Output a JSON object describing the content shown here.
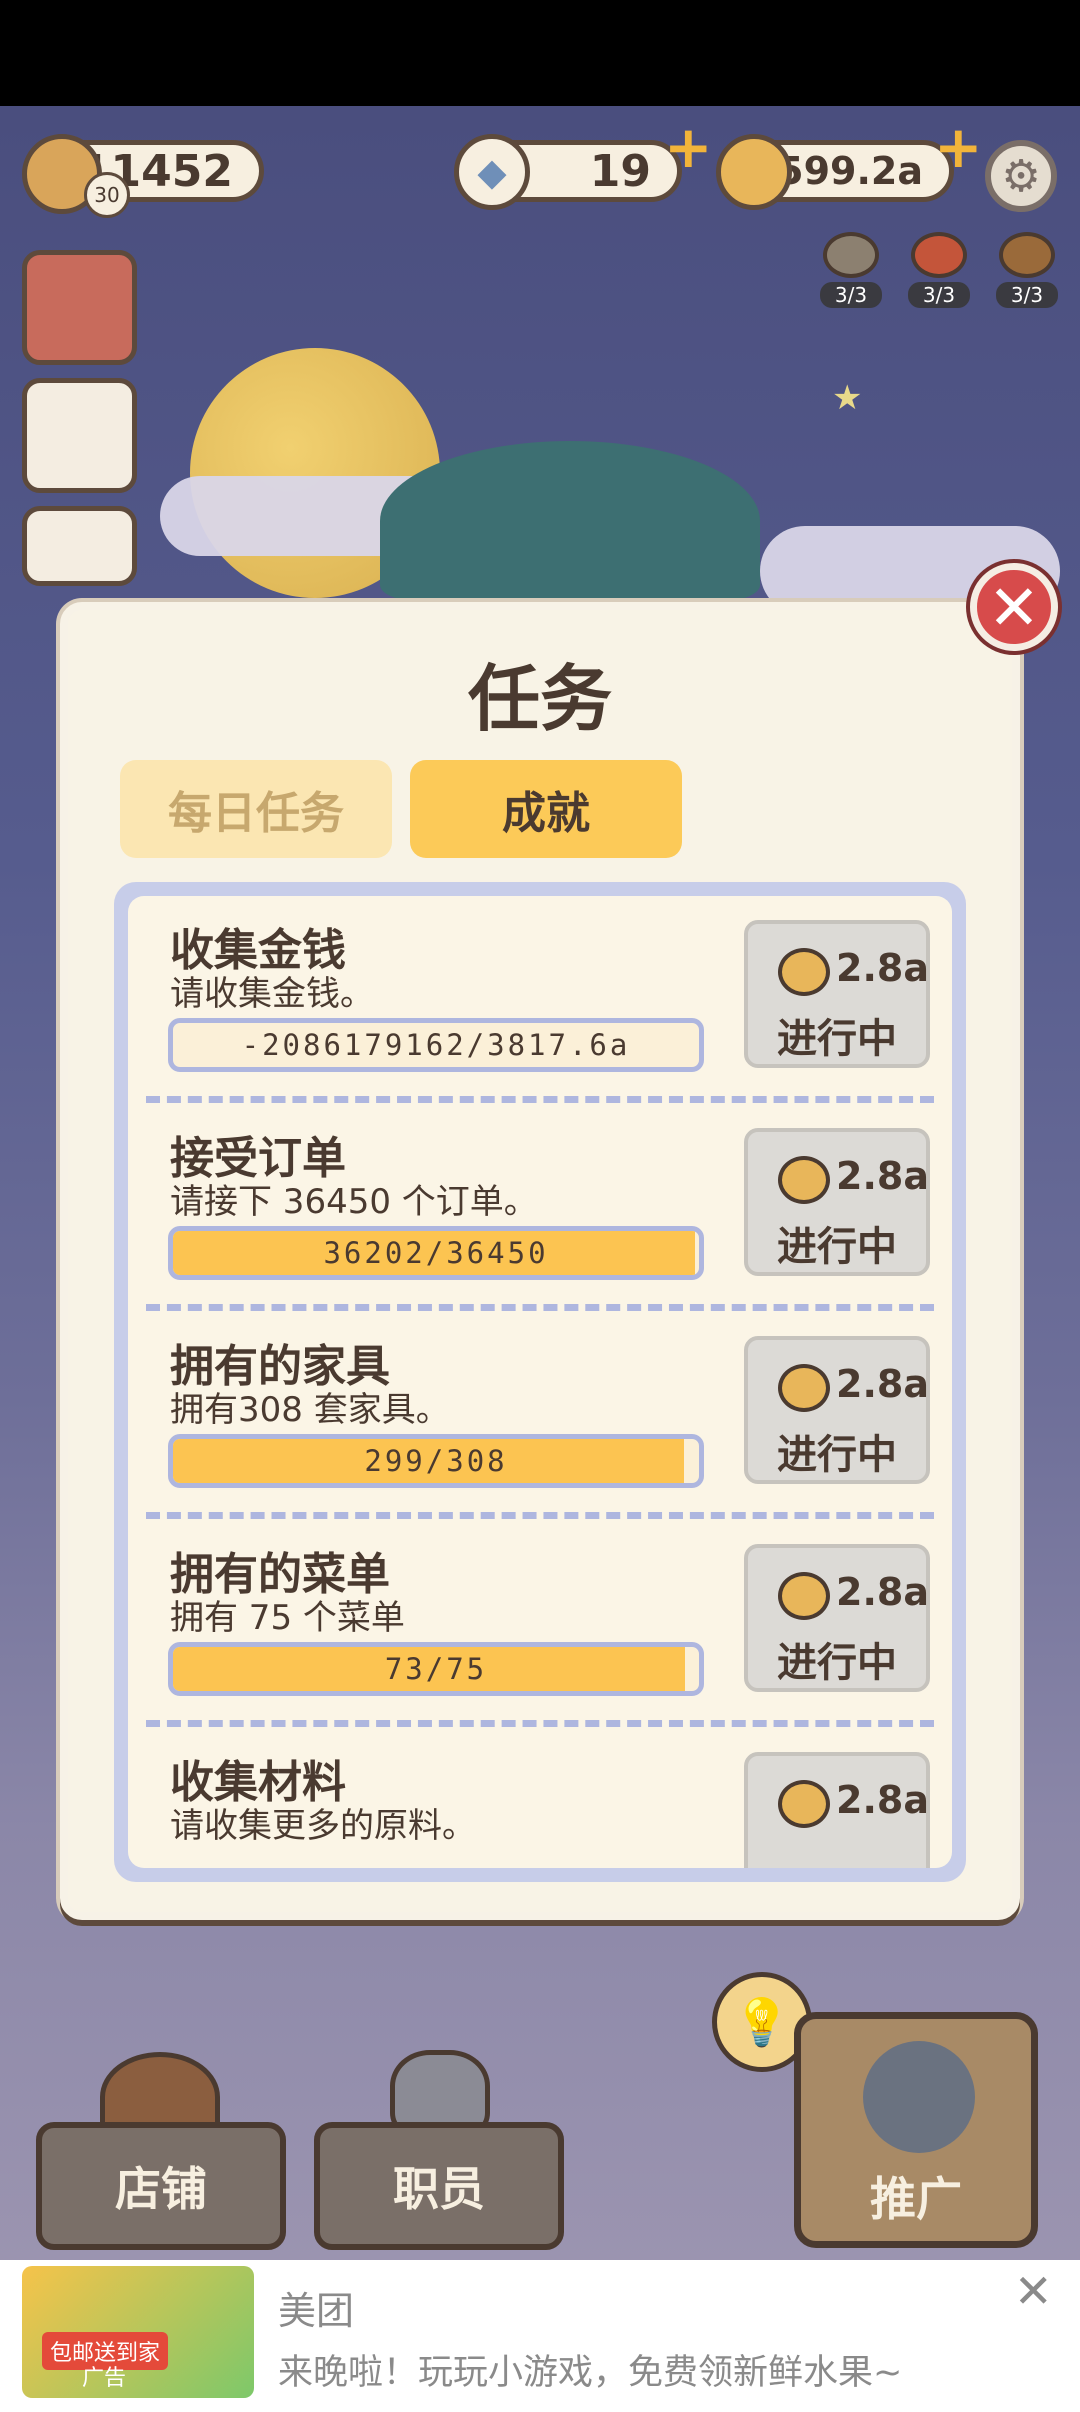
{
  "hud": {
    "player_money": "11452",
    "level": "30",
    "diamonds": "19",
    "coins": "1599.2a"
  },
  "resources": [
    {
      "icon": "mushroom-icon",
      "count": "3/3"
    },
    {
      "icon": "fire-icon",
      "count": "3/3"
    },
    {
      "icon": "drumstick-icon",
      "count": "3/3"
    }
  ],
  "modal": {
    "title": "任务",
    "tabs": [
      {
        "label": "每日任务",
        "active": false
      },
      {
        "label": "成就",
        "active": true
      }
    ],
    "tasks": [
      {
        "title": "收集金钱",
        "desc": "请收集金钱。",
        "progress_text": "-2086179162/3817.6a",
        "progress_fraction": 0,
        "reward": "2.8a",
        "status": "进行中"
      },
      {
        "title": "接受订单",
        "desc": "请接下 36450 个订单。",
        "progress_text": "36202/36450",
        "progress_fraction": 0.993,
        "reward": "2.8a",
        "status": "进行中"
      },
      {
        "title": "拥有的家具",
        "desc": "拥有308 套家具。",
        "progress_text": "299/308",
        "progress_fraction": 0.971,
        "reward": "2.8a",
        "status": "进行中"
      },
      {
        "title": "拥有的菜单",
        "desc": "拥有 75 个菜单",
        "progress_text": "73/75",
        "progress_fraction": 0.973,
        "reward": "2.8a",
        "status": "进行中"
      },
      {
        "title": "收集材料",
        "desc": "请收集更多的原料。",
        "progress_text": "",
        "progress_fraction": 0,
        "reward": "2.8a",
        "status": ""
      }
    ]
  },
  "bottom_nav": {
    "shop": "店铺",
    "staff": "职员",
    "promote": "推广"
  },
  "ad": {
    "brand": "美团",
    "text": "来晚啦！玩玩小游戏，免费领新鲜水果~",
    "tag": "广告",
    "badge": "包邮送到家"
  },
  "colors": {
    "accent": "#fcc451",
    "modal_bg": "#f8f3e6",
    "text": "#4a3a30"
  }
}
